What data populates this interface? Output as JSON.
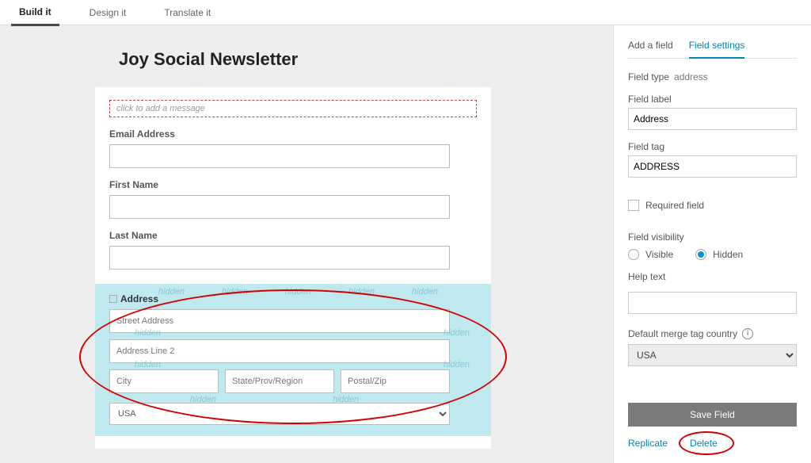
{
  "top_tabs": {
    "build": "Build it",
    "design": "Design it",
    "translate": "Translate it"
  },
  "form": {
    "title": "Joy Social Newsletter",
    "msg_placeholder": "click to add a message",
    "email_label": "Email Address",
    "first_label": "First Name",
    "last_label": "Last Name"
  },
  "address": {
    "label": "Address",
    "street_ph": "Street Address",
    "line2_ph": "Address Line 2",
    "city_ph": "City",
    "state_ph": "State/Prov/Region",
    "postal_ph": "Postal/Zip",
    "country_sel": "USA",
    "wm": "hidden"
  },
  "side": {
    "tab_add": "Add a field",
    "tab_settings": "Field settings",
    "field_type_k": "Field type",
    "field_type_v": "address",
    "field_label_k": "Field label",
    "field_label_v": "Address",
    "field_tag_k": "Field tag",
    "field_tag_v": "ADDRESS",
    "required": "Required field",
    "visibility_k": "Field visibility",
    "vis_visible": "Visible",
    "vis_hidden": "Hidden",
    "help_k": "Help text",
    "default_country_k": "Default merge tag country",
    "default_country_v": "USA",
    "save": "Save Field",
    "replicate": "Replicate",
    "delete": "Delete"
  }
}
